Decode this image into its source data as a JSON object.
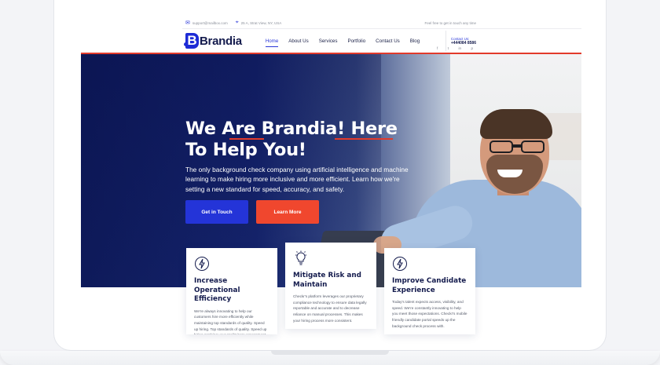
{
  "topbar": {
    "email": "support@mailbox.com",
    "address": "25 A, Strat View, NY, USA",
    "tagline": "Feel free to get in touch any time"
  },
  "header": {
    "logo_mark": "B",
    "logo_text": "Brandia",
    "nav": [
      "Home",
      "About Us",
      "Services",
      "Portfolio",
      "Contact Us",
      "Blog"
    ],
    "active_nav": "Home",
    "contact_label": "Contact Us:",
    "contact_number": "+444084 8586",
    "social": [
      "f",
      "t",
      "in",
      "p"
    ]
  },
  "hero": {
    "title_line1": "We Are Brandia! Here",
    "title_line2": "To Help You!",
    "text": "The only background check company using artificial intelligence and machine learning to make hiring more inclusive and more efficient. Learn how we're setting a new standard for speed, accuracy, and safety.",
    "btn_primary": "Get in Touch",
    "btn_secondary": "Learn More"
  },
  "cards": [
    {
      "icon": "lightning-icon",
      "title": "Increase Operational Efficiency",
      "text": "We're always innovating to help our customers hire more efficiently while maintaining top standards of quality. Speed up hiring. Top standards of quality. Speed up hiring applying your preliminary assessment rules."
    },
    {
      "icon": "lightbulb-icon",
      "title": "Mitigate Risk and Maintain",
      "text": "Checkr's platform leverages our proprietary compliance technology to ensure data legally reportable and accurate and to decrease reliance on manual processes. This makes your hiring process more consistent."
    },
    {
      "icon": "lightning-icon",
      "title": "Improve Candidate Experience",
      "text": "Today's talent expects access, visibility, and speed. We're constantly innovating to help you meet those expectations. Checkr's mobile friendly candidate portal speeds up the background check process with."
    }
  ],
  "colors": {
    "brand_blue": "#2434d8",
    "accent_red": "#f0472e",
    "navy": "#141b4d"
  }
}
